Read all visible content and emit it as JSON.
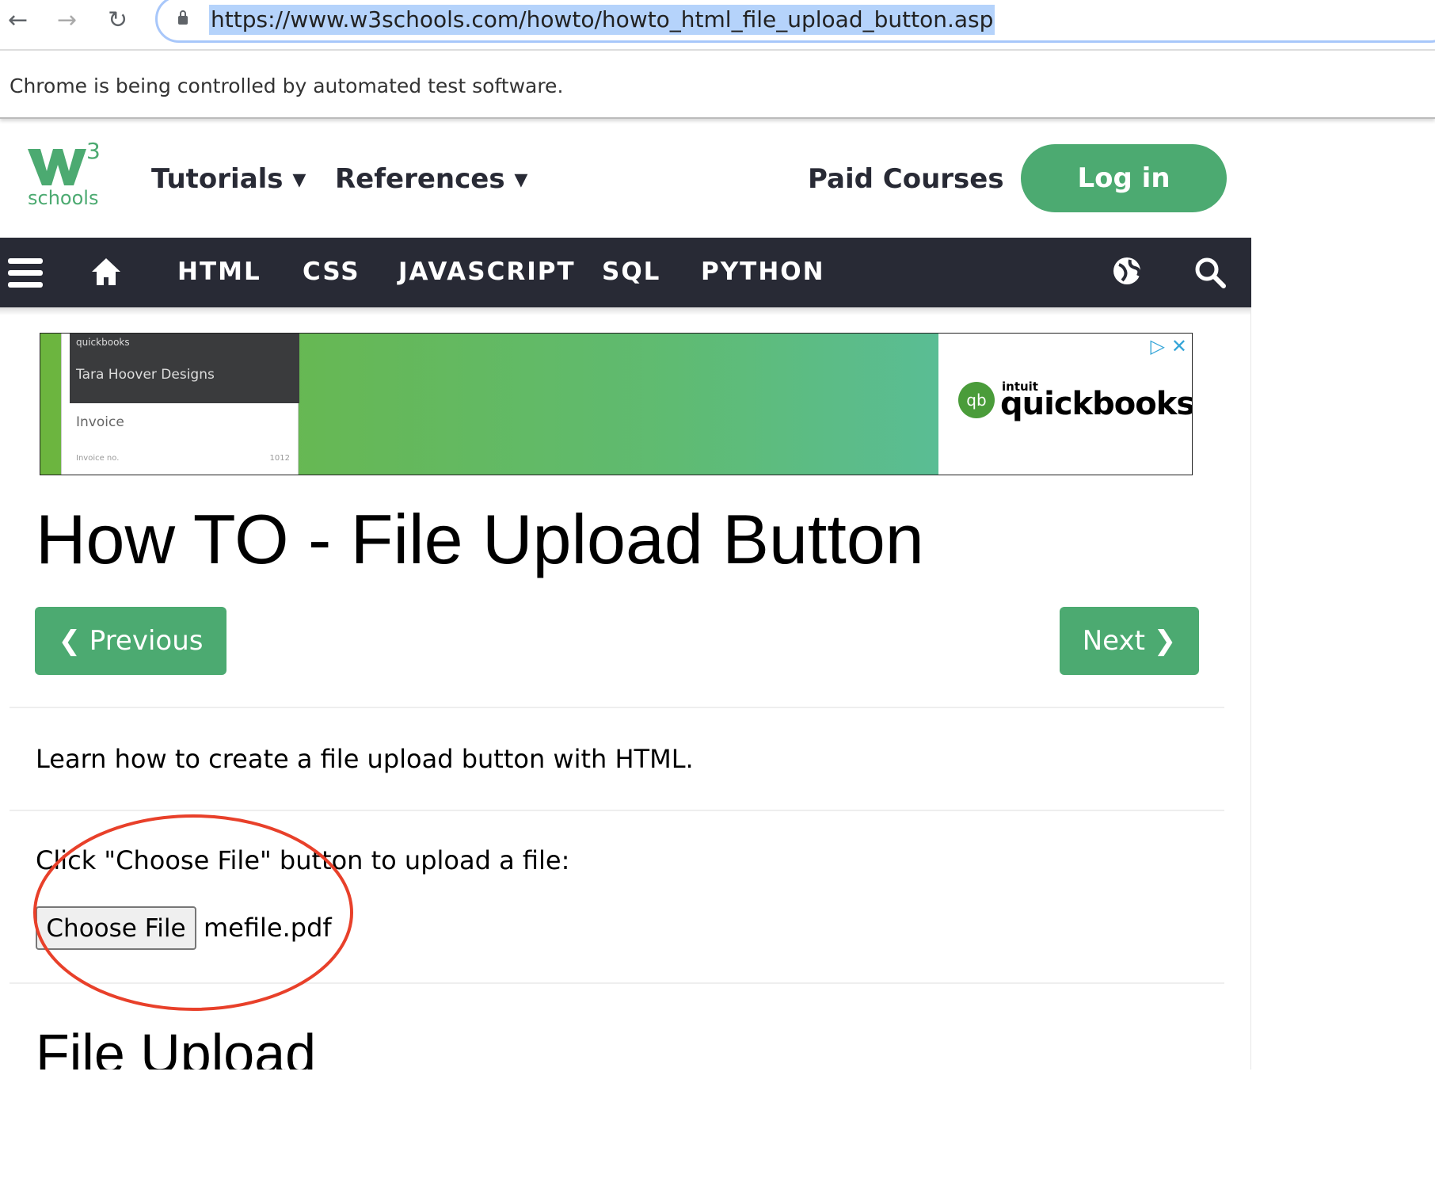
{
  "browser": {
    "url": "https://www.w3schools.com/howto/howto_html_file_upload_button.asp",
    "back_icon": "←",
    "forward_icon": "→",
    "reload_icon": "↻",
    "infobar": "Chrome is being controlled by automated test software."
  },
  "header": {
    "logo_text": "schools",
    "logo_sup": "3",
    "tutorials": "Tutorials ▾",
    "references": "References ▾",
    "paid_courses": "Paid Courses",
    "login": "Log in"
  },
  "topnav": {
    "items": [
      "HTML",
      "CSS",
      "JAVASCRIPT",
      "SQL",
      "PYTHON"
    ]
  },
  "ad": {
    "card_brand": "quickbooks",
    "card_company": "Tara Hoover Designs",
    "card_invoice": "Invoice",
    "card_invoice_no": "Invoice no.",
    "card_number": "1012",
    "brand_small": "intuit",
    "brand": "quickbooks"
  },
  "main": {
    "title": "How TO - File Upload Button",
    "previous": "❮ Previous",
    "next": "Next ❯",
    "intro": "Learn how to create a file upload button with HTML.",
    "instruction": "Click \"Choose File\" button to upload a file:",
    "choose_file": "Choose File",
    "file_name": "mefile.pdf",
    "section_title": "File Upload"
  },
  "colors": {
    "brand_green": "#4caa71",
    "nav_dark": "#282a35",
    "annotation": "#e8402a"
  }
}
